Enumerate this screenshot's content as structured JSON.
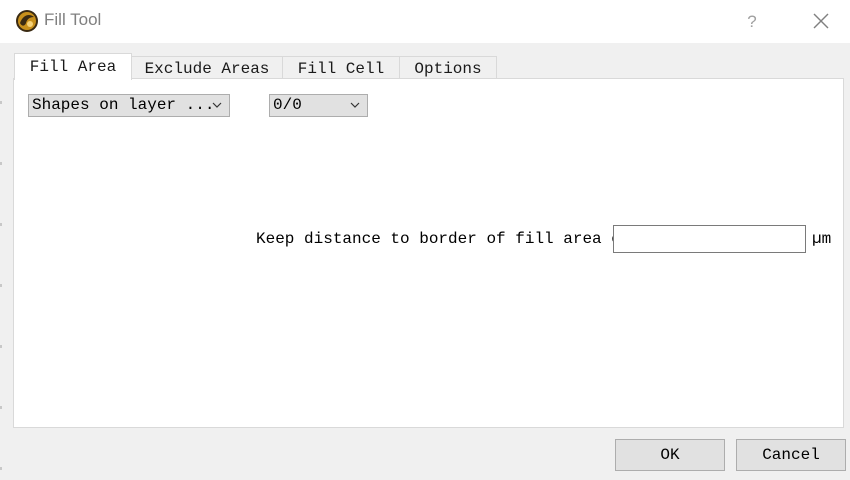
{
  "window": {
    "title": "Fill Tool",
    "help_label": "?"
  },
  "tabs": [
    {
      "label": "Fill Area",
      "active": true
    },
    {
      "label": "Exclude Areas",
      "active": false
    },
    {
      "label": "Fill Cell",
      "active": false
    },
    {
      "label": "Options",
      "active": false
    }
  ],
  "fill_area": {
    "source_select": "Shapes on layer ...",
    "layer_select": "0/0",
    "distance_label": "Keep distance to border of fill area of",
    "distance_value": "",
    "distance_unit": "µm"
  },
  "buttons": {
    "ok": "OK",
    "cancel": "Cancel"
  },
  "icons": {
    "app": "app-logo-icon",
    "close": "close-icon",
    "dropdown": "chevron-down-icon"
  }
}
